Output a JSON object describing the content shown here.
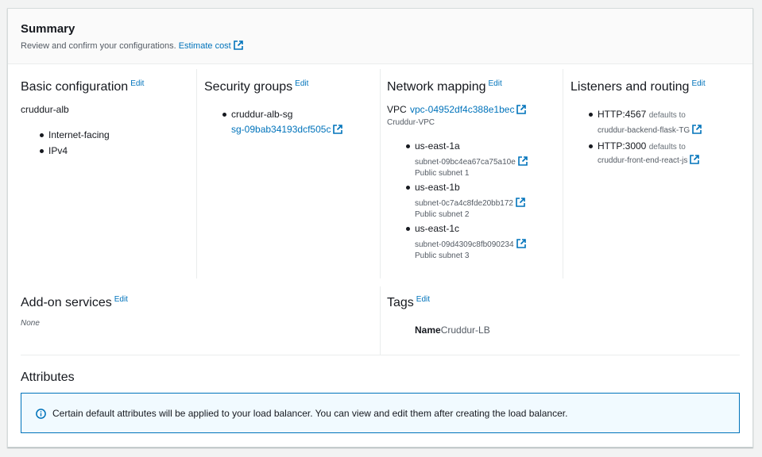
{
  "summary": {
    "title": "Summary",
    "description": "Review and confirm your configurations.",
    "estimate_cost": "Estimate cost"
  },
  "edit_label": "Edit",
  "basic": {
    "title": "Basic configuration",
    "name": "cruddur-alb",
    "items": [
      "Internet-facing",
      "IPv4"
    ]
  },
  "security": {
    "title": "Security groups",
    "group_name": "cruddur-alb-sg",
    "group_id": "sg-09bab34193dcf505c"
  },
  "network": {
    "title": "Network mapping",
    "vpc_label": "VPC",
    "vpc_id": "vpc-04952df4c388e1bec",
    "vpc_name": "Cruddur-VPC",
    "zones": [
      {
        "az": "us-east-1a",
        "subnet": "subnet-09bc4ea67ca75a10e",
        "desc": "Public subnet 1"
      },
      {
        "az": "us-east-1b",
        "subnet": "subnet-0c7a4c8fde20bb172",
        "desc": "Public subnet 2"
      },
      {
        "az": "us-east-1c",
        "subnet": "subnet-09d4309c8fb090234",
        "desc": "Public subnet 3"
      }
    ]
  },
  "listeners": {
    "title": "Listeners and routing",
    "items": [
      {
        "listener": "HTTP:4567",
        "defaults": "defaults to",
        "target": "cruddur-backend-flask-TG"
      },
      {
        "listener": "HTTP:3000",
        "defaults": "defaults to",
        "target": "cruddur-front-end-react-js"
      }
    ]
  },
  "addons": {
    "title": "Add-on services",
    "value": "None"
  },
  "tags": {
    "title": "Tags",
    "key": "Name",
    "value": "Cruddur-LB"
  },
  "attributes": {
    "title": "Attributes",
    "info": "Certain default attributes will be applied to your load balancer. You can view and edit them after creating the load balancer."
  },
  "colors": {
    "link": "#0073bb",
    "info_bg": "#f1faff",
    "info_border": "#0073bb"
  },
  "icons": {
    "external": "external-link-icon",
    "info": "info-circle-icon"
  }
}
